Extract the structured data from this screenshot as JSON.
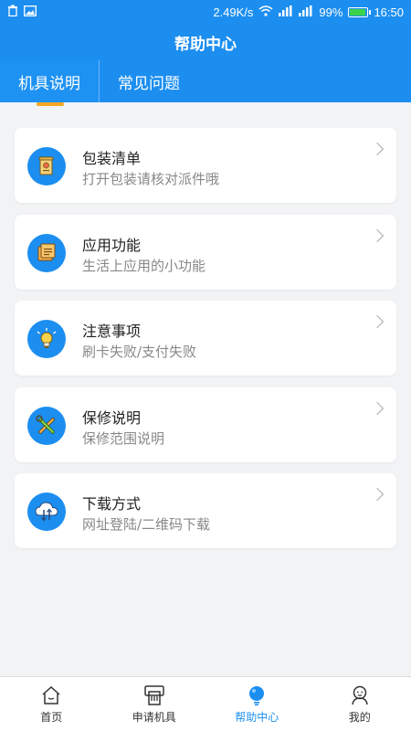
{
  "status_bar": {
    "speed": "2.49K/s",
    "battery_percent": "99%",
    "time": "16:50",
    "battery_level": 0.99
  },
  "header": {
    "title": "帮助中心"
  },
  "tabs": [
    {
      "label": "机具说明",
      "active": true
    },
    {
      "label": "常见问题",
      "active": false
    }
  ],
  "cards": [
    {
      "title": "包装清单",
      "subtitle": "打开包装请核对派件哦",
      "icon": "document-icon"
    },
    {
      "title": "应用功能",
      "subtitle": "生活上应用的小功能",
      "icon": "notes-icon"
    },
    {
      "title": "注意事项",
      "subtitle": "刷卡失败/支付失败",
      "icon": "lightbulb-icon"
    },
    {
      "title": "保修说明",
      "subtitle": "保修范围说明",
      "icon": "tools-icon"
    },
    {
      "title": "下载方式",
      "subtitle": "网址登陆/二维码下载",
      "icon": "cloud-download-icon"
    }
  ],
  "bottom_nav": [
    {
      "label": "首页",
      "icon": "home-icon",
      "active": false
    },
    {
      "label": "申请机具",
      "icon": "pos-terminal-icon",
      "active": false
    },
    {
      "label": "帮助中心",
      "icon": "help-bulb-icon",
      "active": true
    },
    {
      "label": "我的",
      "icon": "user-icon",
      "active": false
    }
  ],
  "colors": {
    "primary": "#1c8ef0",
    "accent": "#f5a623",
    "battery": "#3bd24a"
  }
}
